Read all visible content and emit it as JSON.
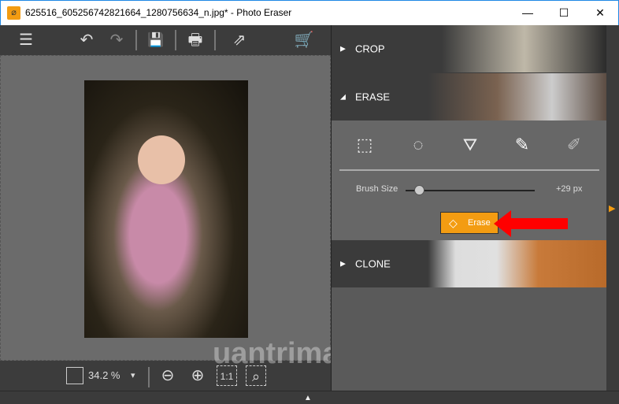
{
  "window": {
    "title": "625516_605256742821664_1280756634_n.jpg* - Photo Eraser",
    "minimize": "—",
    "maximize": "☐",
    "close": "✕"
  },
  "toolbar": {
    "menu": "☰",
    "undo": "↶",
    "redo": "↷",
    "save": "💾",
    "print": "🖶",
    "share": "⇗",
    "cart": "🛒"
  },
  "zoom": {
    "value": "34.2 %",
    "dropdown": "▾",
    "zoom_out": "⊖",
    "zoom_in": "⊕",
    "actual_size": "1:1",
    "fit": "⌕"
  },
  "panel": {
    "crop": {
      "label": "CROP",
      "arrow": "▶"
    },
    "erase": {
      "label": "ERASE",
      "arrow": "◢"
    },
    "tools": [
      "⬚",
      "◌",
      "⛛",
      "✎",
      "✐"
    ],
    "brush_size_label": "Brush Size",
    "brush_size_value": "+29 px",
    "brush_size_fraction": 0.07,
    "erase_button": "Erase",
    "clone": {
      "label": "CLONE",
      "arrow": "▶"
    }
  },
  "watermark": "uantrimang",
  "colors": {
    "accent": "#f39c12",
    "arrow": "#ff0000"
  }
}
